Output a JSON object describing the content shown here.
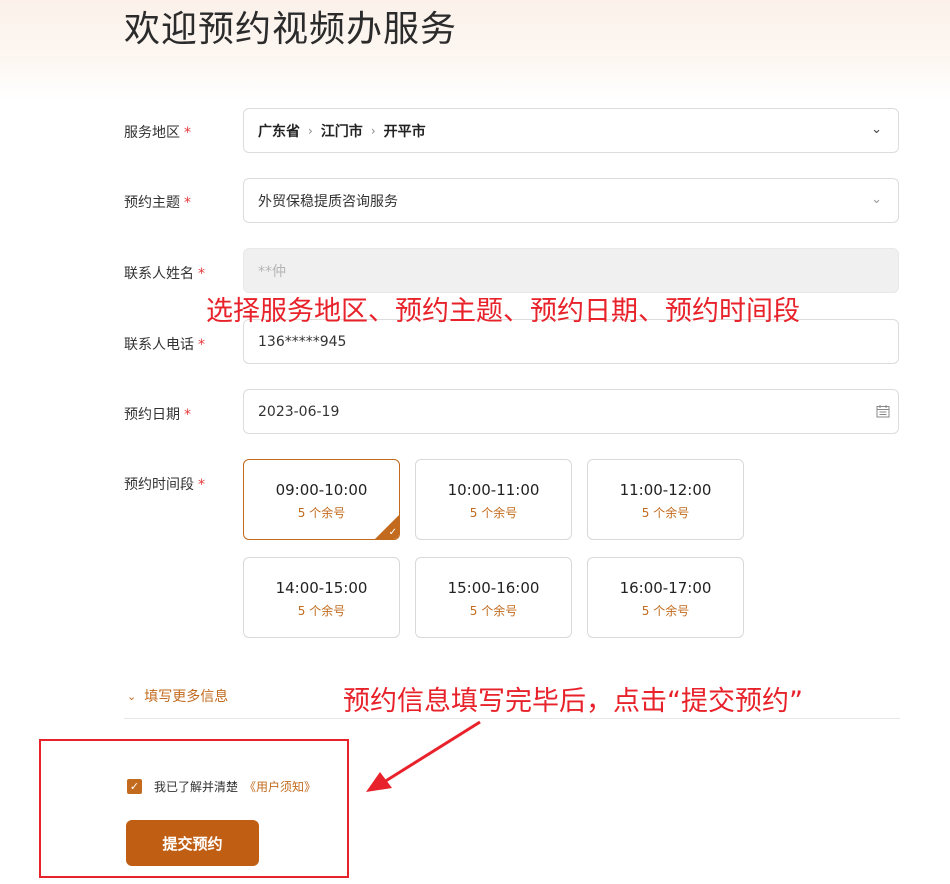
{
  "page": {
    "title": "欢迎预约视频办服务"
  },
  "form": {
    "region": {
      "label": "服务地区",
      "required_mark": "*",
      "parts": [
        "广东省",
        "江门市",
        "开平市"
      ],
      "separator": "›"
    },
    "topic": {
      "label": "预约主题",
      "required_mark": "*",
      "value": "外贸保稳提质咨询服务"
    },
    "contact_name": {
      "label": "联系人姓名",
      "required_mark": "*",
      "value": "**仲"
    },
    "contact_phone": {
      "label": "联系人电话",
      "required_mark": "*",
      "value": "136*****945"
    },
    "date": {
      "label": "预约日期",
      "required_mark": "*",
      "value": "2023-06-19",
      "icon": "calendar-icon"
    },
    "time_slots": {
      "label": "预约时间段",
      "required_mark": "*",
      "slots": [
        {
          "time": "09:00-10:00",
          "remaining": "5 个余号",
          "selected": true
        },
        {
          "time": "10:00-11:00",
          "remaining": "5 个余号",
          "selected": false
        },
        {
          "time": "11:00-12:00",
          "remaining": "5 个余号",
          "selected": false
        },
        {
          "time": "14:00-15:00",
          "remaining": "5 个余号",
          "selected": false
        },
        {
          "time": "15:00-16:00",
          "remaining": "5 个余号",
          "selected": false
        },
        {
          "time": "16:00-17:00",
          "remaining": "5 个余号",
          "selected": false
        }
      ]
    },
    "more_info": {
      "label": "填写更多信息",
      "icon": "chevron-down-icon"
    },
    "agreement": {
      "checked": true,
      "text": "我已了解并清楚",
      "link": "《用户须知》"
    },
    "submit_label": "提交预约"
  },
  "annotations": {
    "instruction_1": "选择服务地区、预约主题、预约日期、预约时间段",
    "instruction_2": "预约信息填写完毕后，点击“提交预约”"
  },
  "colors": {
    "accent": "#c26b1e",
    "button": "#c05f14",
    "required": "#e4393c",
    "annotation": "#e8222a"
  }
}
